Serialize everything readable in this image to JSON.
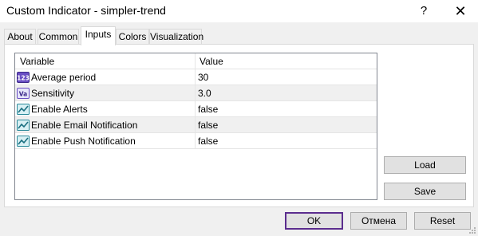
{
  "window": {
    "title": "Custom Indicator - simpler-trend",
    "help_glyph": "?",
    "close_glyph": "✕"
  },
  "tabs": [
    {
      "label": "About"
    },
    {
      "label": "Common"
    },
    {
      "label": "Inputs",
      "active": true
    },
    {
      "label": "Colors"
    },
    {
      "label": "Visualization"
    }
  ],
  "grid": {
    "columns": {
      "variable": "Variable",
      "value": "Value"
    },
    "rows": [
      {
        "icon": "integer-icon",
        "name": "Average period",
        "value": "30"
      },
      {
        "icon": "double-value-icon",
        "name": "Sensitivity",
        "value": "3.0"
      },
      {
        "icon": "boolean-icon",
        "name": "Enable Alerts",
        "value": "false"
      },
      {
        "icon": "boolean-icon",
        "name": "Enable Email Notification",
        "value": "false"
      },
      {
        "icon": "boolean-icon",
        "name": "Enable Push Notification",
        "value": "false"
      }
    ]
  },
  "side_buttons": {
    "load": "Load",
    "save": "Save"
  },
  "footer_buttons": {
    "ok": "OK",
    "cancel": "Отмена",
    "reset": "Reset"
  },
  "colors": {
    "focus_border": "#5b2d8e",
    "grid_border": "#828790"
  }
}
